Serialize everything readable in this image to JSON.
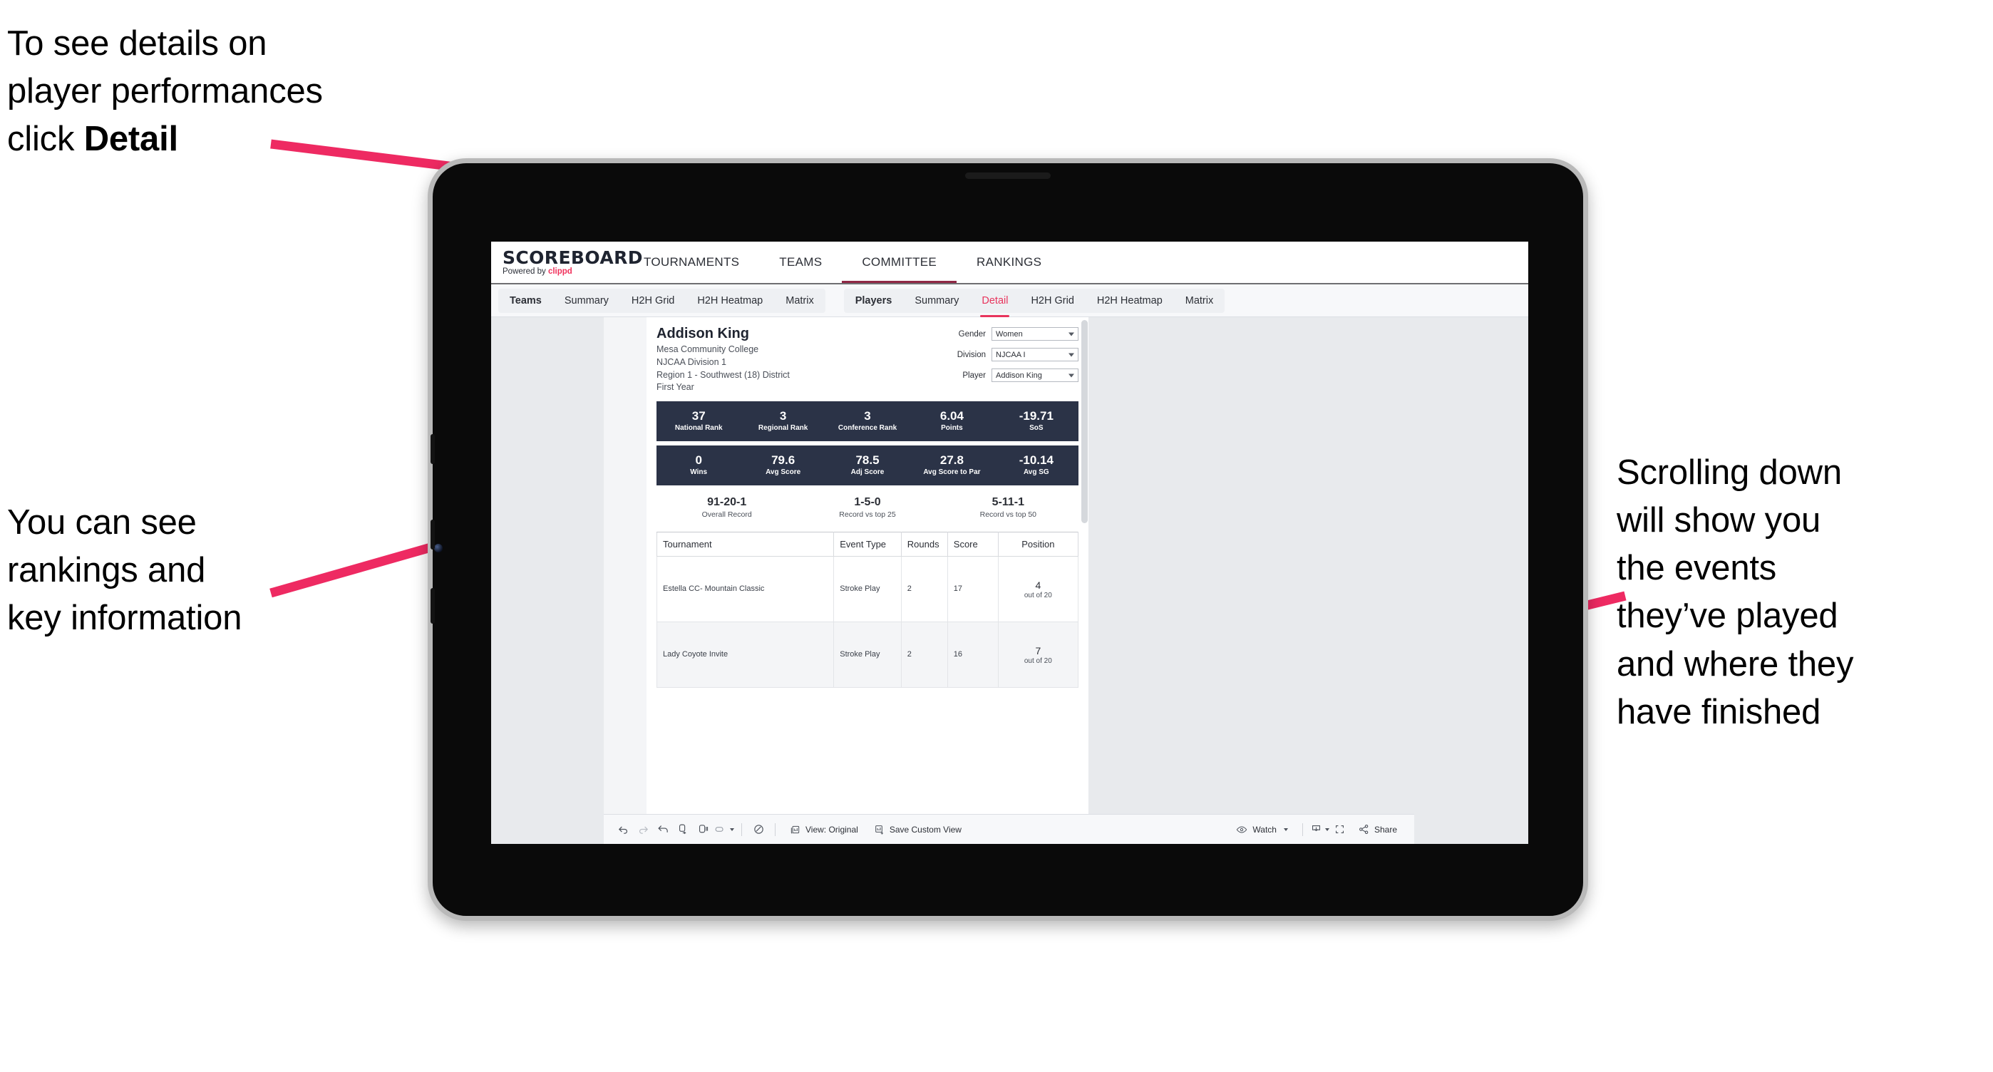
{
  "annotations": {
    "detail_note_a": "To see details on\nplayer performances\nclick ",
    "detail_note_b": "Detail",
    "rankings_note": "You can see\nrankings and\nkey information",
    "scroll_note": "Scrolling down\nwill show you\nthe events\nthey’ve played\nand where they\nhave finished",
    "arrow_color": "#ee2a62"
  },
  "brand": {
    "wordmark": "SCOREBOARD",
    "powered_prefix": "Powered by ",
    "powered_name": "clippd",
    "accent": "#f0325c"
  },
  "topnav": [
    {
      "label": "TOURNAMENTS",
      "active": false
    },
    {
      "label": "TEAMS",
      "active": false
    },
    {
      "label": "COMMITTEE",
      "active": true
    },
    {
      "label": "RANKINGS",
      "active": false
    }
  ],
  "subnav": {
    "teams_group": [
      {
        "label": "Teams",
        "head": true,
        "active": false
      },
      {
        "label": "Summary",
        "head": false,
        "active": false
      },
      {
        "label": "H2H Grid",
        "head": false,
        "active": false
      },
      {
        "label": "H2H Heatmap",
        "head": false,
        "active": false
      },
      {
        "label": "Matrix",
        "head": false,
        "active": false
      }
    ],
    "players_group": [
      {
        "label": "Players",
        "head": true,
        "active": false
      },
      {
        "label": "Summary",
        "head": false,
        "active": false
      },
      {
        "label": "Detail",
        "head": false,
        "active": true
      },
      {
        "label": "H2H Grid",
        "head": false,
        "active": false
      },
      {
        "label": "H2H Heatmap",
        "head": false,
        "active": false
      },
      {
        "label": "Matrix",
        "head": false,
        "active": false
      }
    ]
  },
  "player": {
    "name": "Addison King",
    "school": "Mesa Community College",
    "division": "NJCAA Division 1",
    "region": "Region 1 - Southwest (18) District",
    "year": "First Year"
  },
  "filters": [
    {
      "label": "Gender",
      "value": "Women"
    },
    {
      "label": "Division",
      "value": "NJCAA I"
    },
    {
      "label": "Player",
      "value": "Addison King"
    }
  ],
  "kpi_row_1": [
    {
      "value": "37",
      "label": "National Rank"
    },
    {
      "value": "3",
      "label": "Regional Rank"
    },
    {
      "value": "3",
      "label": "Conference Rank"
    },
    {
      "value": "6.04",
      "label": "Points"
    },
    {
      "value": "-19.71",
      "label": "SoS"
    }
  ],
  "kpi_row_2": [
    {
      "value": "0",
      "label": "Wins"
    },
    {
      "value": "79.6",
      "label": "Avg Score"
    },
    {
      "value": "78.5",
      "label": "Adj Score"
    },
    {
      "value": "27.8",
      "label": "Avg Score to Par"
    },
    {
      "value": "-10.14",
      "label": "Avg SG"
    }
  ],
  "records": [
    {
      "value": "91-20-1",
      "label": "Overall Record"
    },
    {
      "value": "1-5-0",
      "label": "Record vs top 25"
    },
    {
      "value": "5-11-1",
      "label": "Record vs top 50"
    }
  ],
  "events_table": {
    "headers": [
      "Tournament",
      "Event Type",
      "Rounds",
      "Score",
      "Position"
    ],
    "rows": [
      {
        "tournament": "Estella CC- Mountain Classic",
        "event_type": "Stroke Play",
        "rounds": "2",
        "score": "17",
        "position_rank": "4",
        "position_of": "out of 20"
      },
      {
        "tournament": "Lady Coyote Invite",
        "event_type": "Stroke Play",
        "rounds": "2",
        "score": "16",
        "position_rank": "7",
        "position_of": "out of 20"
      }
    ]
  },
  "toolbar": {
    "view_label": "View: Original",
    "save_label": "Save Custom View",
    "watch_label": "Watch",
    "share_label": "Share"
  }
}
